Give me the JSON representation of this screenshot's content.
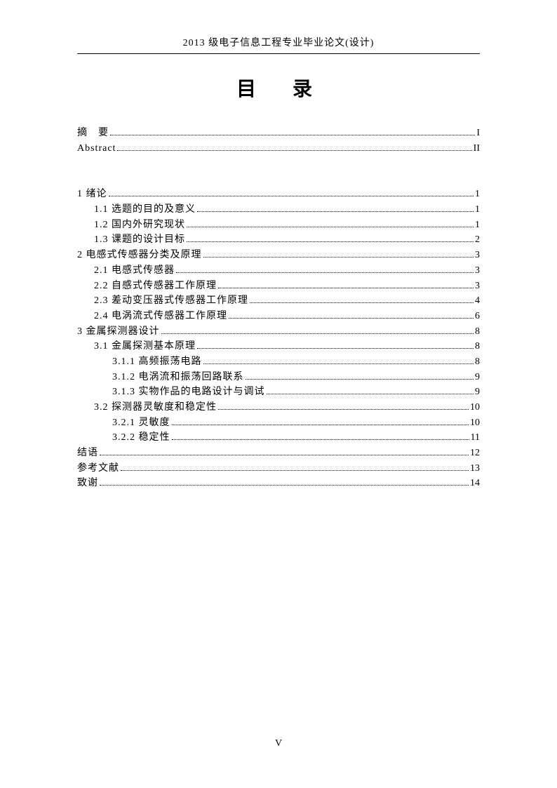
{
  "header": "2013 级电子信息工程专业毕业论文(设计)",
  "title": "目　录",
  "toc_top": [
    {
      "label": "摘　要",
      "page": "I",
      "indent": 0
    },
    {
      "label": "Abstract",
      "page": "II",
      "indent": 0
    }
  ],
  "toc_main": [
    {
      "label": "1 绪论",
      "page": "1",
      "indent": 0
    },
    {
      "label": "1.1 选题的目的及意义",
      "page": "1",
      "indent": 1
    },
    {
      "label": "1.2 国内外研究现状",
      "page": "1",
      "indent": 1
    },
    {
      "label": "1.3 课题的设计目标",
      "page": "2",
      "indent": 1
    },
    {
      "label": "2 电感式传感器分类及原理",
      "page": "3",
      "indent": 0
    },
    {
      "label": "2.1  电感式传感器",
      "page": "3",
      "indent": 1
    },
    {
      "label": "2.2 自感式传感器工作原理",
      "page": "3",
      "indent": 1
    },
    {
      "label": "2.3 差动变压器式传感器工作原理",
      "page": "4",
      "indent": 1
    },
    {
      "label": "2.4 电涡流式传感器工作原理",
      "page": "6",
      "indent": 1
    },
    {
      "label": "3  金属探测器设计",
      "page": "8",
      "indent": 0
    },
    {
      "label": "3.1 金属探测基本原理",
      "page": "8",
      "indent": 1
    },
    {
      "label": "3.1.1 高频振荡电路",
      "page": "8",
      "indent": 2
    },
    {
      "label": "3.1.2 电涡流和振荡回路联系",
      "page": "9",
      "indent": 2
    },
    {
      "label": "3.1.3 实物作品的电路设计与调试",
      "page": "9",
      "indent": 2
    },
    {
      "label": "3.2 探测器灵敏度和稳定性",
      "page": "10",
      "indent": 1
    },
    {
      "label": "3.2.1 灵敏度",
      "page": "10",
      "indent": 2
    },
    {
      "label": "3.2.2 稳定性",
      "page": "11",
      "indent": 2
    },
    {
      "label": "结语",
      "page": "12",
      "indent": 0
    },
    {
      "label": "参考文献",
      "page": "13",
      "indent": 0
    },
    {
      "label": "致谢",
      "page": "14",
      "indent": 0
    }
  ],
  "page_number": "V"
}
